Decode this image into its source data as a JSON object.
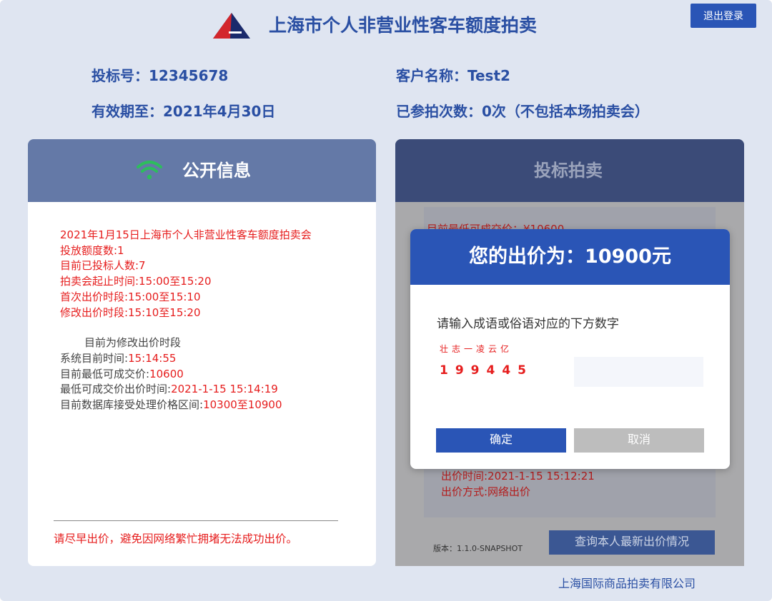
{
  "header": {
    "title": "上海市个人非营业性客车额度拍卖",
    "logout_label": "退出登录",
    "logo_icon": "auction-logo-icon"
  },
  "user_info": {
    "bid_number": "投标号：12345678",
    "customer_name": "客户名称：Test2",
    "valid_until": "有效期至：2021年4月30日",
    "participation_count": "已参拍次数：0次（不包括本场拍卖会）"
  },
  "public_info": {
    "title": "公开信息",
    "icon": "wifi-icon",
    "auction_name": "2021年1月15日上海市个人非营业性客车额度拍卖会",
    "quota": "投放额度数:1",
    "bidders": "目前已投标人数:7",
    "auction_period": "拍卖会起止时间:15:00至15:20",
    "first_bid_period": "首次出价时段:15:00至15:10",
    "modify_bid_period": "修改出价时段:15:10至15:20",
    "current_phase": "目前为修改出价时段",
    "system_time_label": "系统目前时间:",
    "system_time_value": "15:14:55",
    "lowest_price_label": "目前最低可成交价:",
    "lowest_price_value": "10600",
    "lowest_price_time_label": "最低可成交价出价时间:",
    "lowest_price_time_value": "2021-1-15 15:14:19",
    "accept_range_label": "目前数据库接受处理价格区间:",
    "accept_range_value": "10300至10900",
    "warning": "请尽早出价，避免因网络繁忙拥堵无法成功出价。"
  },
  "bid_panel": {
    "title": "投标拍卖",
    "partial_line": "目前最低可成交价：¥10600",
    "bid_time": "出价时间:2021-1-15 15:12:21",
    "bid_method": "出价方式:网络出价",
    "version": "版本：1.1.0-SNAPSHOT",
    "query_label": "查询本人最新出价情况"
  },
  "modal": {
    "title": "您的出价为：10900元",
    "prompt": "请输入成语或俗语对应的下方数字",
    "idiom": "壮志一凌云亿",
    "digits": "199445",
    "input_value": "",
    "confirm_label": "确定",
    "cancel_label": "取消"
  },
  "footer": {
    "company": "上海国际商品拍卖有限公司"
  },
  "colors": {
    "brand_blue": "#2a55b6",
    "title_blue": "#2a4fa3",
    "alert_red": "#e61d1d",
    "wifi_green": "#2dbd5d"
  }
}
